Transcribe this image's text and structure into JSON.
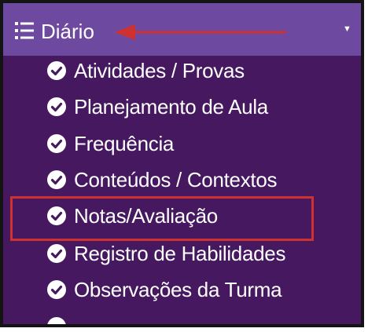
{
  "header": {
    "title": "Diário",
    "icon": "list-icon",
    "caret_icon": "caret-down-icon",
    "background_color": "#6d4aa0"
  },
  "menu": {
    "background_color": "#45185f",
    "item_icon": "check-circle-icon",
    "items": [
      {
        "label": "Atividades / Provas"
      },
      {
        "label": "Planejamento de Aula"
      },
      {
        "label": "Frequência"
      },
      {
        "label": "Conteúdos / Contextos"
      },
      {
        "label": "Notas/Avaliação",
        "highlighted": true
      },
      {
        "label": "Registro de Habilidades"
      },
      {
        "label": "Observações da Turma"
      }
    ]
  },
  "annotations": {
    "color": "#cf3131",
    "arrow_points_to": "header",
    "highlighted_item": "Notas/Avaliação"
  }
}
